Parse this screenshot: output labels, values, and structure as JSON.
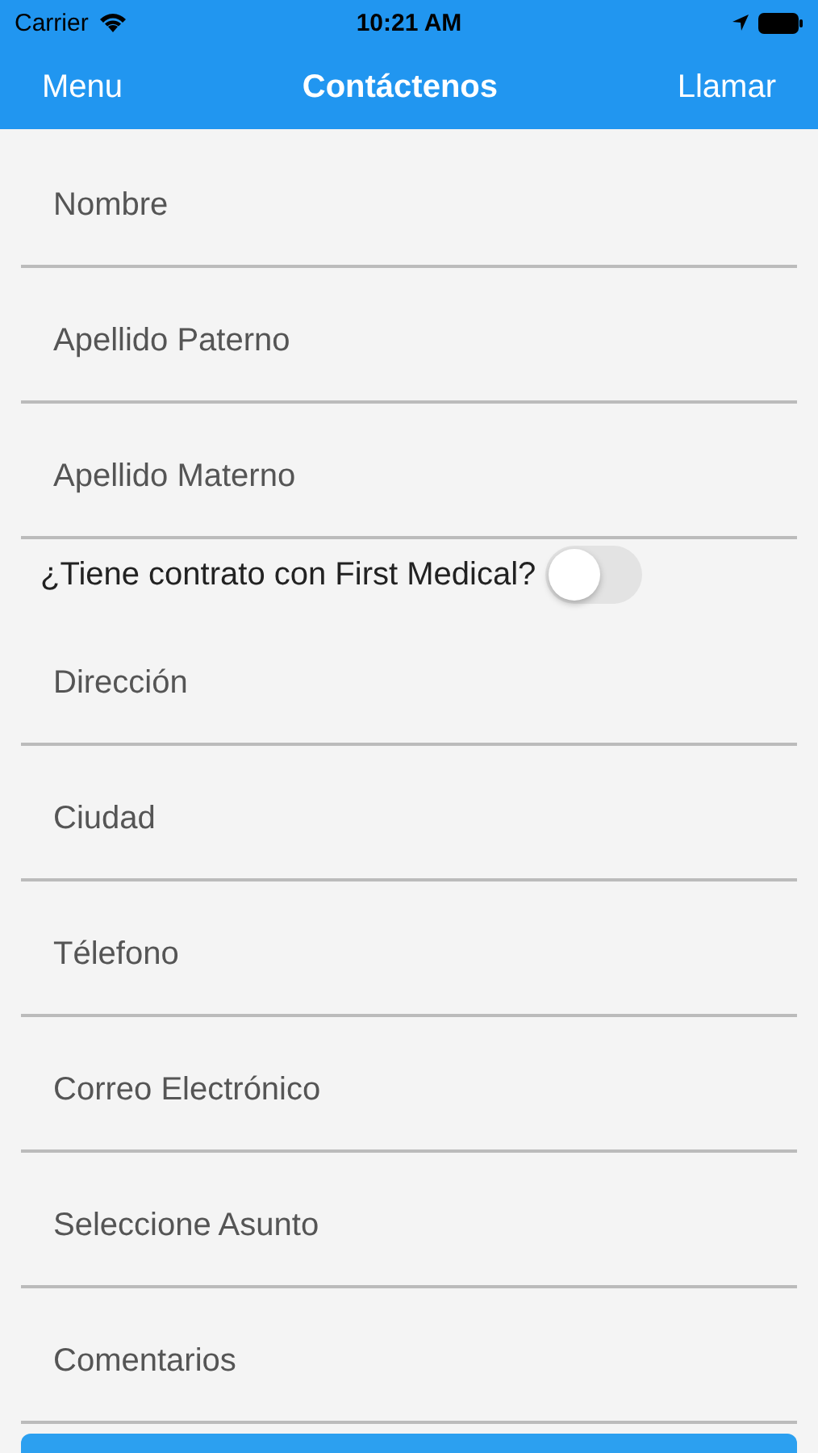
{
  "status_bar": {
    "carrier": "Carrier",
    "time": "10:21 AM"
  },
  "nav": {
    "left": "Menu",
    "title": "Contáctenos",
    "right": "Llamar"
  },
  "form": [
    {
      "kind": "field",
      "placeholder": "Nombre"
    },
    {
      "kind": "field",
      "placeholder": "Apellido Paterno"
    },
    {
      "kind": "field",
      "placeholder": "Apellido Materno"
    },
    {
      "kind": "toggle",
      "label": "¿Tiene contrato con First Medical?",
      "on": false
    },
    {
      "kind": "field",
      "placeholder": "Dirección"
    },
    {
      "kind": "field",
      "placeholder": "Ciudad"
    },
    {
      "kind": "field",
      "placeholder": "Télefono"
    },
    {
      "kind": "field",
      "placeholder": "Correo Electrónico"
    },
    {
      "kind": "field",
      "placeholder": "Seleccione Asunto"
    },
    {
      "kind": "field",
      "placeholder": "Comentarios"
    }
  ]
}
